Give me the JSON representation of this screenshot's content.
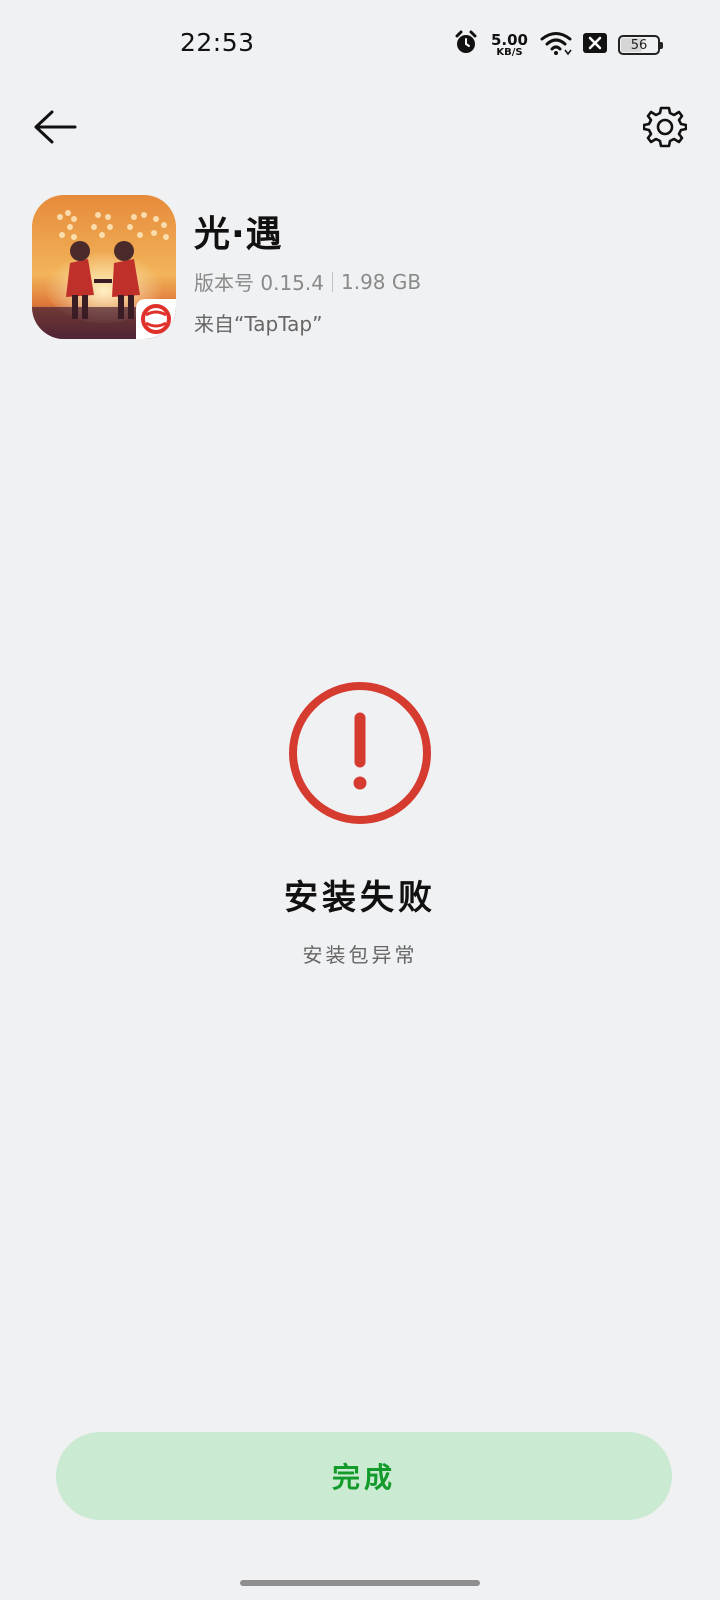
{
  "status_bar": {
    "time": "22:53",
    "net_speed_value": "5.00",
    "net_speed_unit": "KB/S",
    "battery_level": "56",
    "icons": [
      "alarm-icon",
      "wifi-icon",
      "no-sim-icon",
      "battery-icon"
    ]
  },
  "top_bar": {
    "back_icon": "arrow-left-icon",
    "settings_icon": "gear-icon"
  },
  "app": {
    "name": "光·遇",
    "version_label": "版本号 0.15.4",
    "size": "1.98 GB",
    "source": "来自“TapTap”"
  },
  "result": {
    "title": "安装失败",
    "subtitle": "安装包异常",
    "icon": "error-exclamation-icon",
    "icon_color": "#d63b30"
  },
  "actions": {
    "done_label": "完成",
    "done_color": "#129a2a",
    "done_bg": "#cbead2"
  }
}
